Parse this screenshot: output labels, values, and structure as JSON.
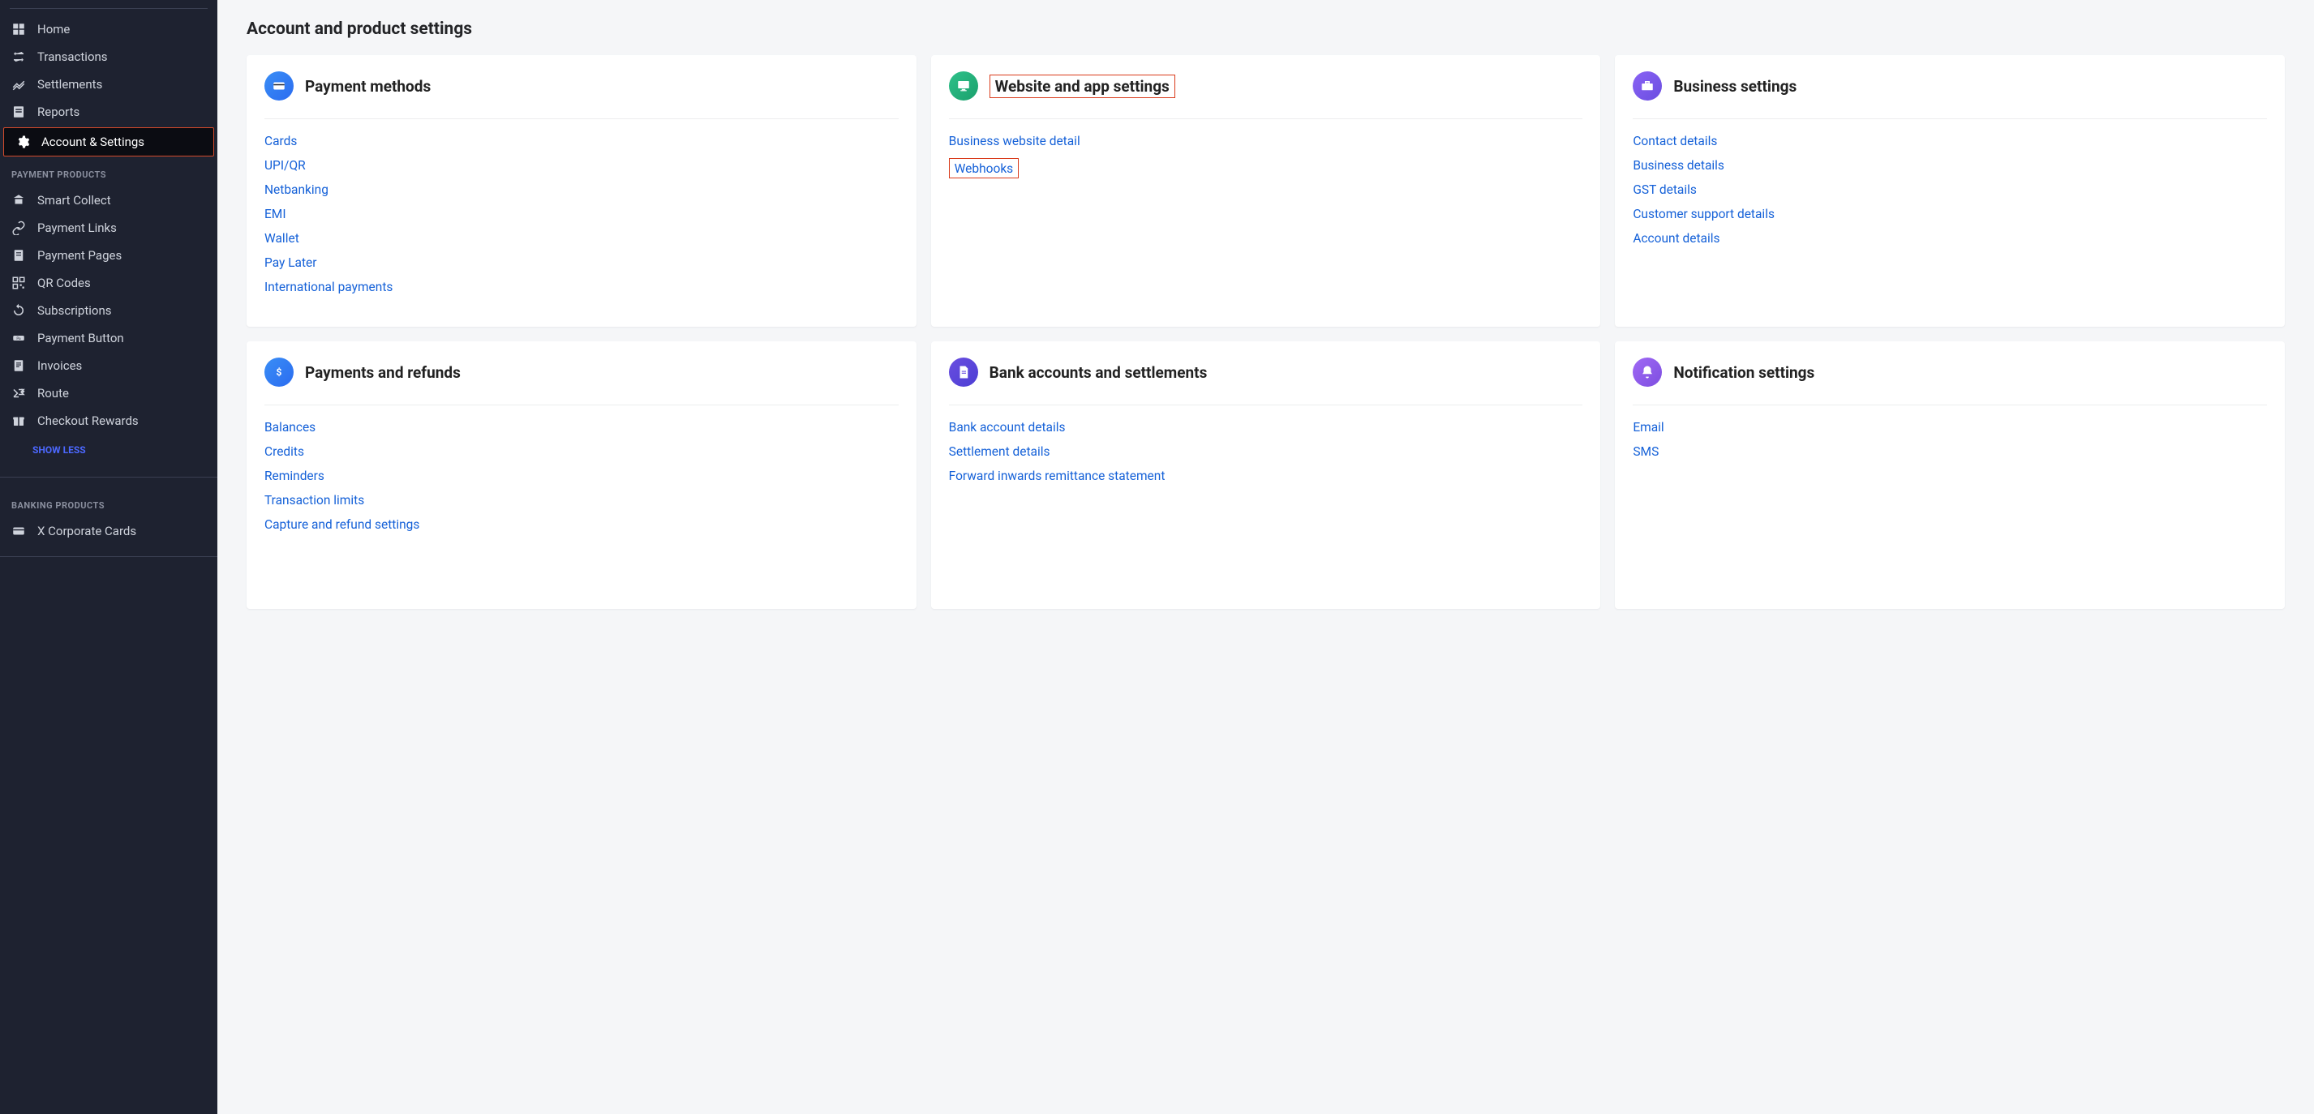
{
  "sidebar": {
    "main_items": [
      {
        "label": "Home",
        "icon": "dashboard-icon"
      },
      {
        "label": "Transactions",
        "icon": "transactions-icon"
      },
      {
        "label": "Settlements",
        "icon": "settlements-icon"
      },
      {
        "label": "Reports",
        "icon": "reports-icon"
      },
      {
        "label": "Account & Settings",
        "icon": "settings-icon",
        "active": true
      }
    ],
    "section_payment_products": "PAYMENT PRODUCTS",
    "payment_products": [
      {
        "label": "Smart Collect",
        "icon": "smart-collect-icon"
      },
      {
        "label": "Payment Links",
        "icon": "link-icon"
      },
      {
        "label": "Payment Pages",
        "icon": "page-icon"
      },
      {
        "label": "QR Codes",
        "icon": "qr-icon"
      },
      {
        "label": "Subscriptions",
        "icon": "subscriptions-icon"
      },
      {
        "label": "Payment Button",
        "icon": "button-icon"
      },
      {
        "label": "Invoices",
        "icon": "invoices-icon"
      },
      {
        "label": "Route",
        "icon": "route-icon"
      },
      {
        "label": "Checkout Rewards",
        "icon": "rewards-icon"
      }
    ],
    "show_less": "SHOW LESS",
    "section_banking_products": "BANKING PRODUCTS",
    "banking_products": [
      {
        "label": "X Corporate Cards",
        "icon": "card-icon"
      }
    ]
  },
  "page": {
    "title": "Account and product settings"
  },
  "cards": [
    {
      "title": "Payment methods",
      "icon_bg": "bg1",
      "icon": "card-icon",
      "highlight_title": false,
      "links": [
        {
          "label": "Cards"
        },
        {
          "label": "UPI/QR"
        },
        {
          "label": "Netbanking"
        },
        {
          "label": "EMI"
        },
        {
          "label": "Wallet"
        },
        {
          "label": "Pay Later"
        },
        {
          "label": "International payments"
        }
      ]
    },
    {
      "title": "Website and app settings",
      "icon_bg": "bg2",
      "icon": "monitor-icon",
      "highlight_title": true,
      "links": [
        {
          "label": "Business website detail"
        },
        {
          "label": "Webhooks",
          "highlight": true
        }
      ]
    },
    {
      "title": "Business settings",
      "icon_bg": "bg3",
      "icon": "briefcase-icon",
      "highlight_title": false,
      "links": [
        {
          "label": "Contact details"
        },
        {
          "label": "Business details"
        },
        {
          "label": "GST details"
        },
        {
          "label": "Customer support details"
        },
        {
          "label": "Account details"
        }
      ]
    },
    {
      "title": "Payments and refunds",
      "icon_bg": "bg4",
      "icon": "dollar-icon",
      "highlight_title": false,
      "links": [
        {
          "label": "Balances"
        },
        {
          "label": "Credits"
        },
        {
          "label": "Reminders"
        },
        {
          "label": "Transaction limits"
        },
        {
          "label": "Capture and refund settings"
        }
      ]
    },
    {
      "title": "Bank accounts and settlements",
      "icon_bg": "bg5",
      "icon": "document-icon",
      "highlight_title": false,
      "links": [
        {
          "label": "Bank account details"
        },
        {
          "label": "Settlement details"
        },
        {
          "label": "Forward inwards remittance statement"
        }
      ]
    },
    {
      "title": "Notification settings",
      "icon_bg": "bg6",
      "icon": "bell-icon",
      "highlight_title": false,
      "links": [
        {
          "label": "Email"
        },
        {
          "label": "SMS"
        }
      ]
    }
  ]
}
